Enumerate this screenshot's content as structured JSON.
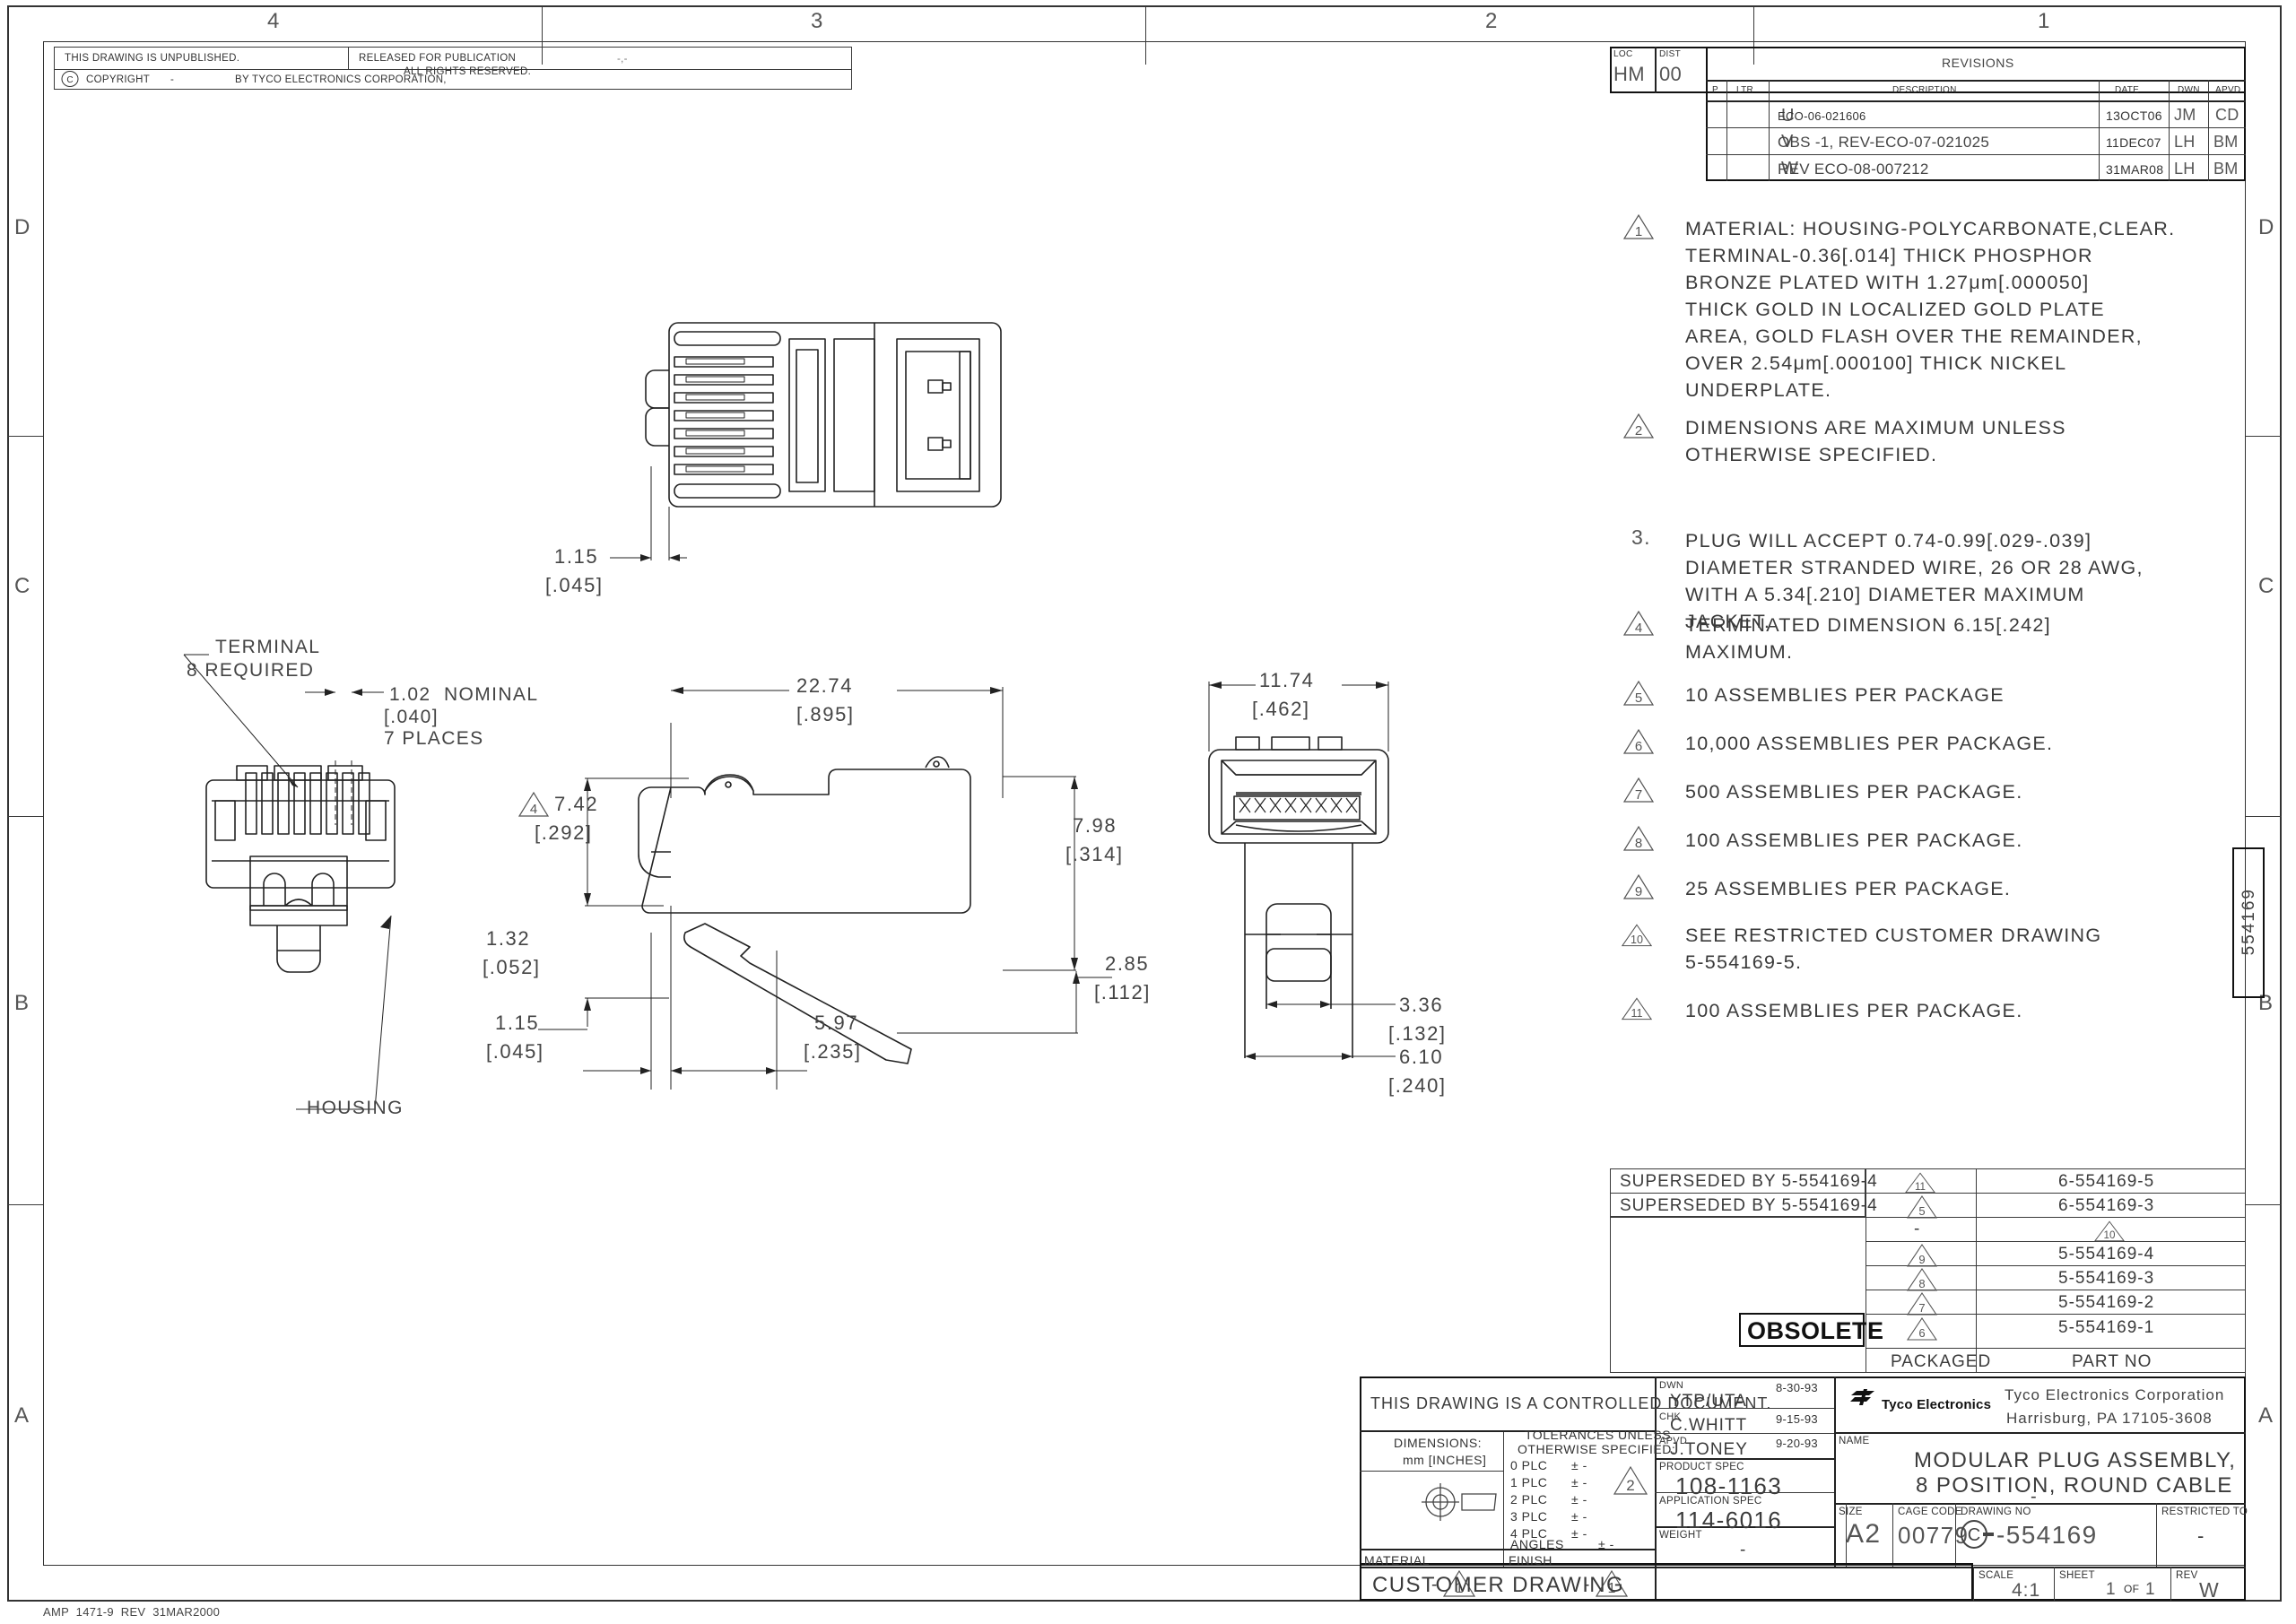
{
  "sheet": {
    "zone_numbers": [
      "4",
      "3",
      "2",
      "1"
    ],
    "zone_letters": [
      "D",
      "C",
      "B",
      "A"
    ],
    "footer": "AMP  1471-9  REV  31MAR2000",
    "side_part_label": "554169"
  },
  "header": {
    "unpublished": "THIS DRAWING IS UNPUBLISHED.",
    "released": "RELEASED FOR PUBLICATION",
    "released_value": "-,-",
    "copyright_symbol": "C",
    "copyright": "COPYRIGHT",
    "copyright_dash": "-",
    "copyright_by": "BY TYCO ELECTRONICS CORPORATION,",
    "rights": "ALL RIGHTS RESERVED."
  },
  "loc_dist": {
    "loc_label": "LOC",
    "loc_value": "HM",
    "dist_label": "DIST",
    "dist_value": "00"
  },
  "revisions": {
    "title": "REVISIONS",
    "columns": [
      "P",
      "LTR",
      "DESCRIPTION",
      "DATE",
      "DWN",
      "APVD"
    ],
    "rows": [
      {
        "p": "",
        "ltr": "U",
        "description": "ECO-06-021606",
        "date": "13OCT06",
        "dwn": "JM",
        "apvd": "CD"
      },
      {
        "p": "",
        "ltr": "V",
        "description": "OBS -1, REV-ECO-07-021025",
        "date": "11DEC07",
        "dwn": "LH",
        "apvd": "BM"
      },
      {
        "p": "",
        "ltr": "W",
        "description": "REV ECO-08-007212",
        "date": "31MAR08",
        "dwn": "LH",
        "apvd": "BM"
      }
    ]
  },
  "notes": [
    {
      "flag": "1",
      "triangle": true,
      "lines": [
        "MATERIAL: HOUSING-POLYCARBONATE,CLEAR.",
        "TERMINAL-0.36[.014] THICK PHOSPHOR",
        "BRONZE PLATED WITH 1.27μm[.000050]",
        "THICK GOLD IN LOCALIZED GOLD PLATE",
        "AREA, GOLD FLASH OVER THE REMAINDER,",
        "OVER 2.54μm[.000100] THICK NICKEL",
        "UNDERPLATE."
      ]
    },
    {
      "flag": "2",
      "triangle": true,
      "lines": [
        "DIMENSIONS ARE MAXIMUM UNLESS",
        "OTHERWISE SPECIFIED."
      ]
    },
    {
      "flag": "3.",
      "triangle": false,
      "lines": [
        "PLUG WILL ACCEPT 0.74-0.99[.029-.039]",
        "DIAMETER STRANDED WIRE, 26 OR 28 AWG,",
        "WITH A 5.34[.210] DIAMETER MAXIMUM",
        "JACKET."
      ]
    },
    {
      "flag": "4",
      "triangle": true,
      "lines": [
        "TERMINATED DIMENSION 6.15[.242]",
        "MAXIMUM."
      ]
    },
    {
      "flag": "5",
      "triangle": true,
      "lines": [
        "10 ASSEMBLIES PER PACKAGE"
      ]
    },
    {
      "flag": "6",
      "triangle": true,
      "lines": [
        "10,000 ASSEMBLIES PER PACKAGE."
      ]
    },
    {
      "flag": "7",
      "triangle": true,
      "lines": [
        "500 ASSEMBLIES PER PACKAGE."
      ]
    },
    {
      "flag": "8",
      "triangle": true,
      "lines": [
        "100 ASSEMBLIES PER PACKAGE."
      ]
    },
    {
      "flag": "9",
      "triangle": true,
      "lines": [
        "25 ASSEMBLIES PER PACKAGE."
      ]
    },
    {
      "flag": "10",
      "triangle": true,
      "lines": [
        "SEE RESTRICTED CUSTOMER DRAWING",
        "5-554169-5."
      ]
    },
    {
      "flag": "11",
      "triangle": true,
      "lines": [
        "100 ASSEMBLIES PER PACKAGE."
      ]
    }
  ],
  "drawing": {
    "top_view": {
      "dim_1": "1.15",
      "dim_1_in": "[.045]"
    },
    "left_view": {
      "terminal_label_l1": "TERMINAL",
      "terminal_label_l2": "8 REQUIRED",
      "nominal_l1": "1.02  NOMINAL",
      "nominal_l2": "[.040]",
      "nominal_l3": "7 PLACES",
      "housing_label": "HOUSING"
    },
    "side_view": {
      "width_mm": "22.74",
      "width_in": "[.895]",
      "h1_flag": "4",
      "h1_mm": "7.42",
      "h1_in": "[.292]",
      "h2_mm": "7.98",
      "h2_in": "[.314]",
      "d1_mm": "1.32",
      "d1_in": "[.052]",
      "d2_mm": "2.85",
      "d2_in": "[.112]",
      "d3_mm": "1.15",
      "d3_in": "[.045]",
      "d4_mm": "5.97",
      "d4_in": "[.235]"
    },
    "end_view": {
      "w_mm": "11.74",
      "w_in": "[.462]",
      "d1_mm": "3.36",
      "d1_in": "[.132]",
      "d2_mm": "6.10",
      "d2_in": "[.240]"
    }
  },
  "part_table": {
    "footer_packaged": "PACKAGED",
    "footer_partno": "PART NO",
    "obsolete_stamp": "OBSOLETE",
    "rows": [
      {
        "status": "SUPERSEDED BY 5-554169-4",
        "packaged": "11",
        "packaged_tri": true,
        "partno": "6-554169-5",
        "partno_tri": false
      },
      {
        "status": "SUPERSEDED BY 5-554169-4",
        "packaged": "5",
        "packaged_tri": true,
        "partno": "6-554169-3",
        "partno_tri": false
      },
      {
        "status": "",
        "packaged": "-",
        "packaged_tri": false,
        "partno": "10",
        "partno_tri": true
      },
      {
        "status": "",
        "packaged": "9",
        "packaged_tri": true,
        "partno": "5-554169-4",
        "partno_tri": false
      },
      {
        "status": "",
        "packaged": "8",
        "packaged_tri": true,
        "partno": "5-554169-3",
        "partno_tri": false
      },
      {
        "status": "",
        "packaged": "7",
        "packaged_tri": true,
        "partno": "5-554169-2",
        "partno_tri": false
      },
      {
        "status": "",
        "packaged": "6",
        "packaged_tri": true,
        "partno": "5-554169-1",
        "partno_tri": false
      }
    ]
  },
  "title_block": {
    "controlled": "THIS DRAWING IS A CONTROLLED DOCUMENT.",
    "dimensions_label": "DIMENSIONS:",
    "dimensions_value": "mm [INCHES]",
    "tolerances_l1": "TOLERANCES UNLESS",
    "tolerances_l2": "OTHERWISE SPECIFIED:",
    "plc_rows": [
      {
        "label": "0 PLC",
        "value": "± -"
      },
      {
        "label": "1 PLC",
        "value": "± -"
      },
      {
        "label": "2 PLC",
        "value": "± -"
      },
      {
        "label": "3 PLC",
        "value": "± -"
      },
      {
        "label": "4 PLC",
        "value": "± -"
      }
    ],
    "angles_label": "ANGLES",
    "angles_value": "± -",
    "tol_flag": "2",
    "material_label": "MATERIAL",
    "material_value": "-",
    "material_flag": "1",
    "finish_label": "FINISH",
    "finish_value": "-",
    "finish_flag": "1",
    "dwn_label": "DWN",
    "dwn_name": "YTP/UTA",
    "dwn_date": "8-30-93",
    "chk_label": "CHK",
    "chk_name": "C.WHITT",
    "chk_date": "9-15-93",
    "apvd_label": "APVD",
    "apvd_name": "J.TONEY",
    "apvd_date": "9-20-93",
    "product_spec_label": "PRODUCT SPEC",
    "product_spec_value": "108-1163",
    "application_spec_label": "APPLICATION SPEC",
    "application_spec_value": "114-6016",
    "weight_label": "WEIGHT",
    "weight_value": "-",
    "customer_drawing": "CUSTOMER DRAWING",
    "company_logo": "Tyco Electronics",
    "company_l1": "Tyco Electronics Corporation",
    "company_l2": "Harrisburg, PA 17105-3608",
    "name_label": "NAME",
    "name_l1": "MODULAR PLUG ASSEMBLY,",
    "name_l2": "8 POSITION, ROUND CABLE",
    "name_l3": "-",
    "size_label": "SIZE",
    "size_value": "A2",
    "cage_label": "CAGE CODE",
    "cage_value": "00779",
    "drawing_no_label": "DRAWING NO",
    "drawing_no_prefix": "C",
    "drawing_no_value": "-554169",
    "restricted_label": "RESTRICTED TO",
    "restricted_value": "-",
    "scale_label": "SCALE",
    "scale_value": "4:1",
    "sheet_label": "SHEET",
    "sheet_value": "1",
    "sheet_of": "OF",
    "sheet_total": "1",
    "rev_label": "REV",
    "rev_value": "W"
  }
}
